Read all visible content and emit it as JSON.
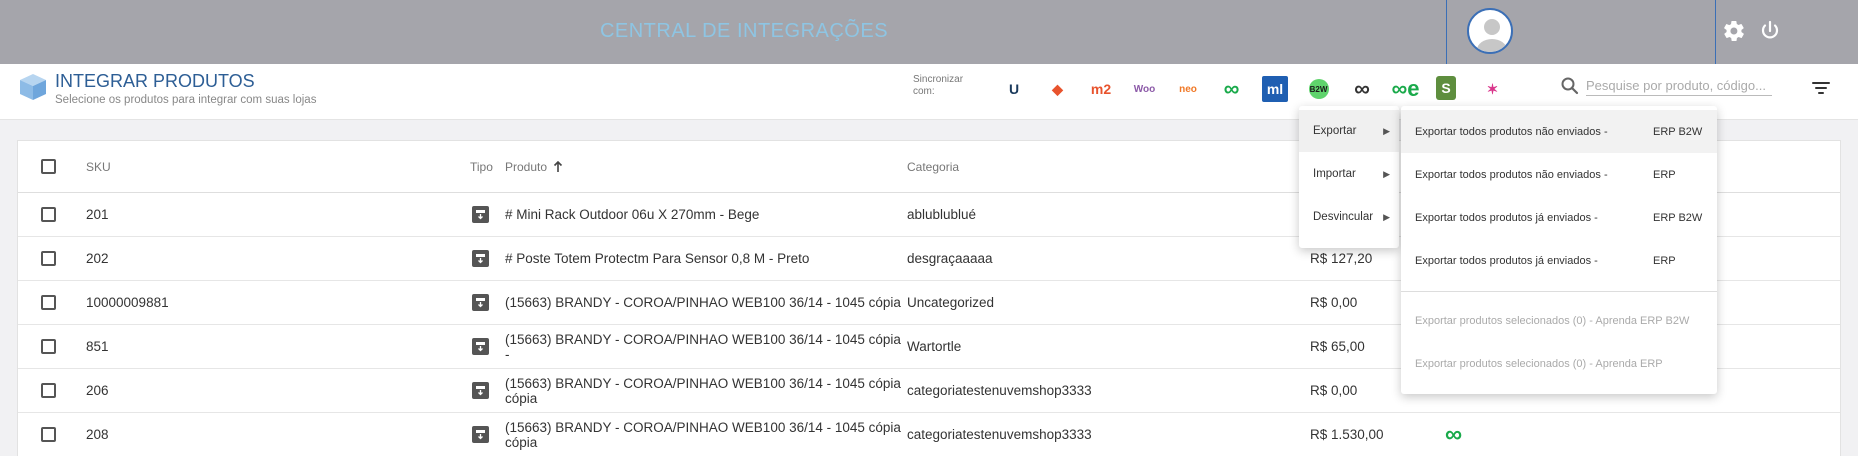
{
  "header": {
    "app_title": "CENTRAL DE INTEGRAÇÕES",
    "avatar_icon": "user-avatar-icon",
    "settings_icon": "gear-icon",
    "logout_icon": "power-icon"
  },
  "subheader": {
    "title": "INTEGRAR PRODUTOS",
    "subtitle": "Selecione os produtos para integrar com suas lojas",
    "sync_label": "Sincronizar com:",
    "integrations": [
      {
        "name": "u-icon",
        "glyph": "U",
        "color": "#1a3a5c"
      },
      {
        "name": "magento-icon",
        "glyph": "◆",
        "color": "#e8532d"
      },
      {
        "name": "magento2-icon",
        "glyph": "m2",
        "color": "#e8532d"
      },
      {
        "name": "woocommerce-icon",
        "glyph": "Woo",
        "color": "#8c5aa8"
      },
      {
        "name": "neo-icon",
        "glyph": "neo",
        "color": "#f07826"
      },
      {
        "name": "infinity-icon",
        "glyph": "∞",
        "color": "#1aaa4b"
      },
      {
        "name": "mercadolivre-icon",
        "glyph": "ml",
        "color": "#ffffff"
      },
      {
        "name": "b2w-icon",
        "glyph": "B2W",
        "color": "#1a1a1a"
      },
      {
        "name": "link-icon",
        "glyph": "∞",
        "color": "#333333"
      },
      {
        "name": "infinity-e-icon",
        "glyph": "∞e",
        "color": "#1aaa4b"
      },
      {
        "name": "shopify-icon",
        "glyph": "S",
        "color": "#5e8e3e"
      },
      {
        "name": "star-icon",
        "glyph": "✶",
        "color": "#d9368b"
      }
    ],
    "search_placeholder": "Pesquise por produto, código...",
    "filter_icon": "filter-icon"
  },
  "table": {
    "columns": {
      "sku": "SKU",
      "tipo": "Tipo",
      "produto": "Produto",
      "categoria": "Categoria"
    },
    "sort_icon": "arrow-up-icon",
    "rows": [
      {
        "sku": "201",
        "produto": "# Mini Rack Outdoor 06u X 270mm - Bege",
        "categoria": "ablublublué",
        "preco": "",
        "integrated": false
      },
      {
        "sku": "202",
        "produto": "# Poste Totem Protectm Para Sensor 0,8 M - Preto",
        "categoria": "desgraçaaaaa",
        "preco": "R$ 127,20",
        "integrated": false
      },
      {
        "sku": "10000009881",
        "produto": "(15663) BRANDY - COROA/PINHAO WEB100 36/14 - 1045 cópia",
        "categoria": "Uncategorized",
        "preco": "R$ 0,00",
        "integrated": false
      },
      {
        "sku": "851",
        "produto": "(15663) BRANDY - COROA/PINHAO WEB100 36/14 - 1045 cópia -",
        "categoria": "Wartortle",
        "preco": "R$ 65,00",
        "integrated": false
      },
      {
        "sku": "206",
        "produto": "(15663) BRANDY - COROA/PINHAO WEB100 36/14 - 1045 cópia cópia",
        "categoria": "categoriatestenuvemshop3333",
        "preco": "R$ 0,00",
        "integrated": false
      },
      {
        "sku": "208",
        "produto": "(15663) BRANDY - COROA/PINHAO WEB100 36/14 - 1045 cópia cópia",
        "categoria": "categoriatestenuvemshop3333",
        "preco": "R$ 1.530,00",
        "integrated": true
      }
    ]
  },
  "menu": {
    "items": [
      {
        "label": "Exportar",
        "active": true
      },
      {
        "label": "Importar",
        "active": false
      },
      {
        "label": "Desvincular",
        "active": false
      }
    ],
    "submenu": [
      {
        "label": "Exportar todos produtos não enviados -",
        "erp": "ERP B2W",
        "active": true,
        "disabled": false
      },
      {
        "label": "Exportar todos produtos não enviados -",
        "erp": "ERP",
        "active": false,
        "disabled": false
      },
      {
        "label": "Exportar todos produtos já enviados -",
        "erp": "ERP B2W",
        "active": false,
        "disabled": false
      },
      {
        "label": "Exportar todos produtos já enviados -",
        "erp": "ERP",
        "active": false,
        "disabled": false
      },
      {
        "label": "Exportar produtos selecionados (0) - Aprenda ERP B2W",
        "erp": "",
        "active": false,
        "disabled": true
      },
      {
        "label": "Exportar produtos selecionados (0) - Aprenda ERP",
        "erp": "",
        "active": false,
        "disabled": true
      }
    ]
  }
}
